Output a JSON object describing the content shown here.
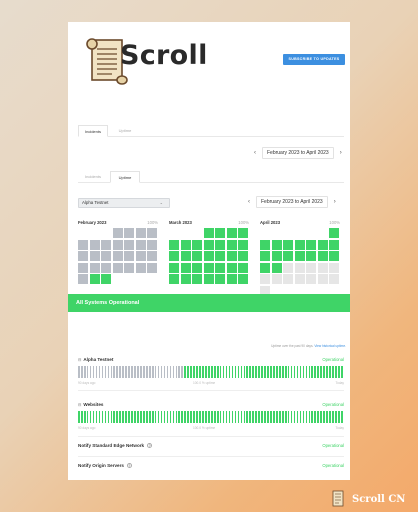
{
  "header": {
    "logo_text": "Scroll",
    "subscribe_label": "SUBSCRIBE TO UPDATES"
  },
  "top_tabs": [
    {
      "label": "Incidents",
      "active": true
    },
    {
      "label": "Uptime",
      "active": false
    }
  ],
  "top_date_range": "February 2023 to April 2023",
  "uptime_tabs": [
    {
      "label": "Incidents",
      "active": false
    },
    {
      "label": "Uptime",
      "active": true
    }
  ],
  "component_select": {
    "value": "Alpha Testnet"
  },
  "calendar_range": "February 2023 to April 2023",
  "months": [
    {
      "name": "February 2023",
      "pct": "100%"
    },
    {
      "name": "March 2023",
      "pct": "100%"
    },
    {
      "name": "April 2023",
      "pct": "100%"
    }
  ],
  "colors": {
    "operational": "#3fd467",
    "nodata": "#b9bec6",
    "future": "#e6e6e6",
    "accent": "#3c8fe0"
  },
  "banner": {
    "text": "All Systems Operational"
  },
  "uptime_note": {
    "text": "Uptime over the past 90 days.",
    "link": "View historical uptime."
  },
  "components": [
    {
      "name": "Alpha Testnet",
      "status": "Operational",
      "uptime": "100.0 % uptime",
      "left": "90 days ago",
      "right": "Today",
      "nodata_fraction": 0.4
    },
    {
      "name": "Websites",
      "status": "Operational",
      "uptime": "100.0 % uptime",
      "left": "90 days ago",
      "right": "Today",
      "nodata_fraction": 0
    }
  ],
  "simple_components": [
    {
      "name": "Notify Standard Edge Network",
      "status": "Operational"
    },
    {
      "name": "Notify Origin Servers",
      "status": "Operational"
    }
  ],
  "watermark": {
    "text": "Scroll CN"
  }
}
